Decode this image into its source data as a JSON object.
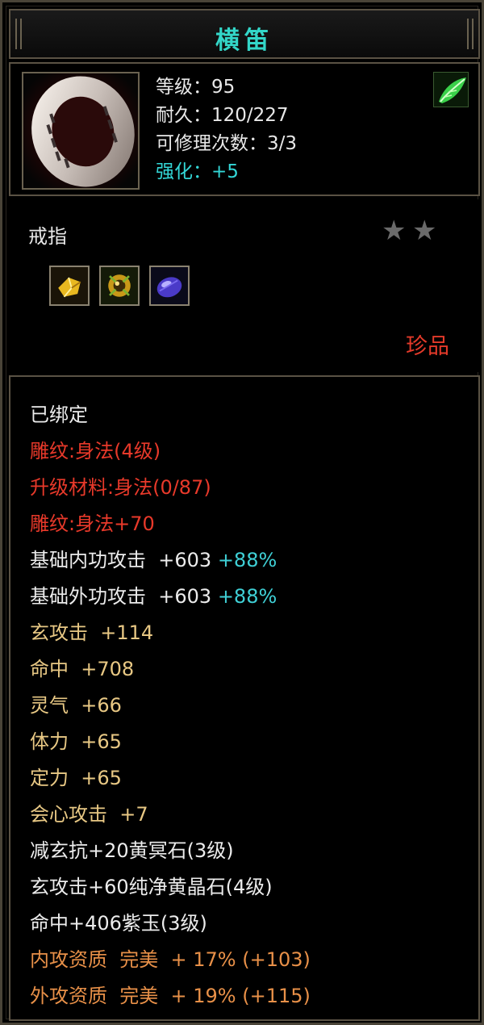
{
  "title": "横笛",
  "header": {
    "item_icon": "ring-icon",
    "class_icon": "green-leaf-icon",
    "stats": [
      "等级：95",
      "耐久：120/227",
      "可修理次数：3/3"
    ],
    "enhance": "强化：+5"
  },
  "type": {
    "label": "戒指",
    "stars": [
      "★",
      "★"
    ],
    "gems": [
      "yellow-gem-icon",
      "amber-gem-icon",
      "purple-gem-icon"
    ],
    "rarity": "珍品"
  },
  "properties": {
    "bound": "已绑定",
    "engrave_1": "雕纹:身法(4级)",
    "upgrade_material": "升级材料:身法(0/87)",
    "engrave_2": "雕纹:身法+70",
    "inner_attack_label": "基础内功攻击  +603 ",
    "inner_attack_pct": "+88%",
    "outer_attack_label": "基础外功攻击  +603 ",
    "outer_attack_pct": "+88%",
    "xuan_attack": "玄攻击  +114",
    "hit": "命中  +708",
    "spirit": "灵气  +66",
    "stamina": "体力  +65",
    "focus": "定力  +65",
    "crit": "会心攻击  +7",
    "gem_1": "减玄抗+20黄冥石(3级)",
    "gem_2": "玄攻击+60纯净黄晶石(4级)",
    "gem_3": "命中+406紫玉(3级)",
    "quality_inner": "内攻资质  完美  + 17% (+103)",
    "quality_outer": "外攻资质  完美  + 19% (+115)"
  },
  "colors": {
    "title": "#33d6c8",
    "enhance": "#33d6d6",
    "rarity": "#e43a2a",
    "engrave": "#e8392a",
    "stat": "#e8c884",
    "percent": "#3fd0d6",
    "quality": "#e89048"
  }
}
